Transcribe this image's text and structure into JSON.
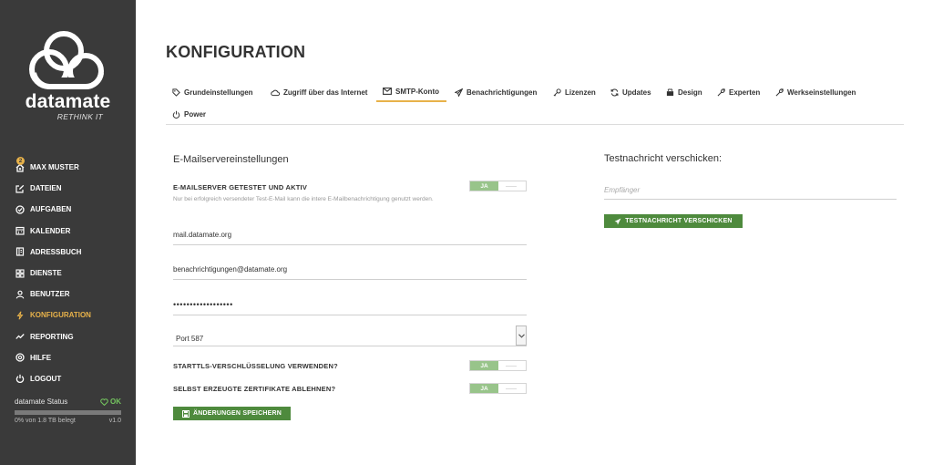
{
  "sidebar": {
    "brand": "datamate",
    "tagline": "RETHINK IT",
    "user_badge": "2",
    "items": [
      {
        "label": "MAX MUSTER",
        "icon": "user-house-icon"
      },
      {
        "label": "DATEIEN",
        "icon": "edit-icon"
      },
      {
        "label": "AUFGABEN",
        "icon": "tasks-icon"
      },
      {
        "label": "KALENDER",
        "icon": "calendar-icon"
      },
      {
        "label": "ADRESSBUCH",
        "icon": "addressbook-icon"
      },
      {
        "label": "DIENSTE",
        "icon": "services-icon"
      },
      {
        "label": "BENUTZER",
        "icon": "users-icon"
      },
      {
        "label": "KONFIGURATION",
        "icon": "bolt-icon",
        "active": true
      },
      {
        "label": "REPORTING",
        "icon": "chart-icon"
      },
      {
        "label": "HILFE",
        "icon": "help-icon"
      },
      {
        "label": "LOGOUT",
        "icon": "power-icon"
      }
    ],
    "status": {
      "title": "datamate Status",
      "state": "OK",
      "usage": "0% von 1.8 TB belegt",
      "usage_percent": 0,
      "version": "v1.0"
    }
  },
  "main": {
    "title": "KONFIGURATION",
    "tabs": [
      {
        "label": "Grundeinstellungen",
        "icon": "tag-icon"
      },
      {
        "label": "Zugriff über das Internet",
        "icon": "cloud-icon"
      },
      {
        "label": "SMTP-Konto",
        "icon": "envelope-icon",
        "active": true
      },
      {
        "label": "Benachrichtigungen",
        "icon": "paper-plane-icon"
      },
      {
        "label": "Lizenzen",
        "icon": "key-icon"
      },
      {
        "label": "Updates",
        "icon": "refresh-icon"
      },
      {
        "label": "Design",
        "icon": "gift-icon"
      },
      {
        "label": "Experten",
        "icon": "wrench-icon"
      },
      {
        "label": "Werkseinstellungen",
        "icon": "wrench-icon"
      },
      {
        "label": "Power",
        "icon": "power-icon"
      }
    ],
    "email_settings": {
      "heading": "E-Mailservereinstellungen",
      "server_active_label": "E-MAILSERVER GETESTET UND AKTIV",
      "server_active_value": "JA",
      "server_active_help": "Nur bei erfolgreich versendeter Test-E-Mail kann die intere E-Mailbenachrichtigung genutzt werden.",
      "host": "mail.datamate.org",
      "username": "benachrichtigungen@datamate.org",
      "password": "••••••••••••••••••",
      "port": "Port 587",
      "starttls_label": "STARTTLS-VERSCHLÜSSELUNG VERWENDEN?",
      "starttls_value": "JA",
      "reject_selfsigned_label": "SELBST ERZEUGTE ZERTIFIKATE ABLEHNEN?",
      "reject_selfsigned_value": "JA",
      "save_label": "ÄNDERUNGEN SPEICHERN"
    },
    "test_message": {
      "heading": "Testnachricht verschicken:",
      "recipient_placeholder": "Empfänger",
      "send_label": "TESTNACHRICHT VERSCHICKEN"
    }
  },
  "colors": {
    "sidebar_bg": "#3a3a3a",
    "accent": "#e8b24a",
    "primary_button": "#4e8a3d",
    "toggle_on": "#98c48a",
    "status_ok": "#74c45f"
  }
}
